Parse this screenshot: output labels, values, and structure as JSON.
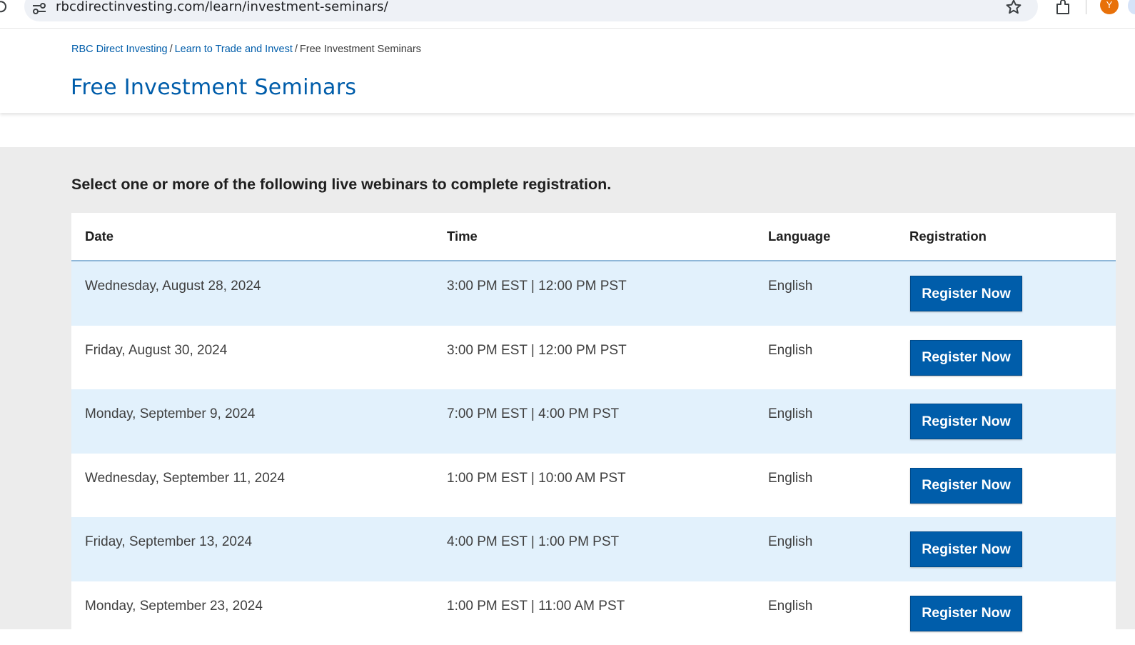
{
  "browser": {
    "url": "rbcdirectinvesting.com/learn/investment-seminars/",
    "profile_initial": "Y",
    "icons": {
      "reload": "reload-icon",
      "site_info": "site-info-icon",
      "bookmark": "star-icon",
      "extensions": "extensions-icon"
    }
  },
  "breadcrumb": {
    "items": [
      {
        "label": "RBC Direct Investing",
        "link": true
      },
      {
        "label": "Learn to Trade and Invest",
        "link": true
      },
      {
        "label": "Free Investment Seminars",
        "link": false
      }
    ],
    "separator": "/"
  },
  "page": {
    "title": "Free Investment Seminars",
    "instruction": "Select one or more of the following live webinars to complete registration."
  },
  "table": {
    "headers": {
      "date": "Date",
      "time": "Time",
      "language": "Language",
      "registration": "Registration"
    },
    "rows": [
      {
        "date": "Wednesday, August 28, 2024",
        "time": "3:00 PM EST | 12:00 PM PST",
        "language": "English",
        "button": "Register Now"
      },
      {
        "date": "Friday, August 30, 2024",
        "time": "3:00 PM EST | 12:00 PM PST",
        "language": "English",
        "button": "Register Now"
      },
      {
        "date": "Monday, September 9, 2024",
        "time": "7:00 PM EST | 4:00 PM PST",
        "language": "English",
        "button": "Register Now"
      },
      {
        "date": "Wednesday, September 11, 2024",
        "time": "1:00 PM EST | 10:00 AM PST",
        "language": "English",
        "button": "Register Now"
      },
      {
        "date": "Friday, September 13, 2024",
        "time": "4:00 PM EST | 1:00 PM PST",
        "language": "English",
        "button": "Register Now"
      },
      {
        "date": "Monday, September 23, 2024",
        "time": "1:00 PM EST | 11:00 AM PST",
        "language": "English",
        "button": "Register Now"
      }
    ]
  },
  "colors": {
    "brand_blue": "#005daa",
    "row_highlight": "#e2f1fc",
    "content_background": "#ececec",
    "avatar": "#e8710a"
  }
}
